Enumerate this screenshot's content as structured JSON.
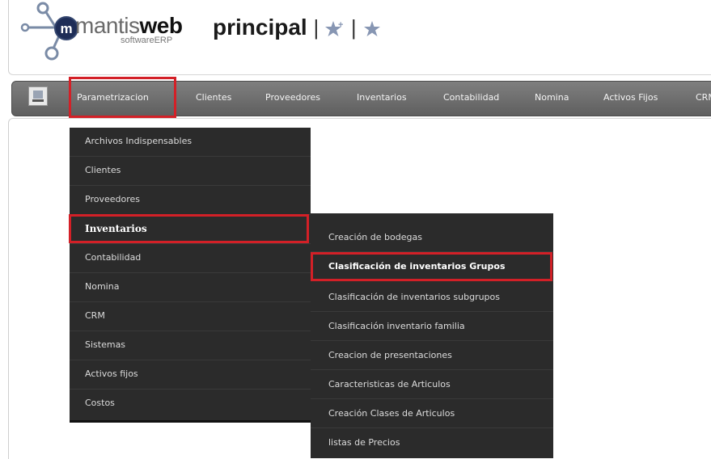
{
  "logo": {
    "word_light": "mantis",
    "word_bold": "web",
    "subtitle": "softwareERP"
  },
  "header": {
    "title": "principal",
    "sep1": "|",
    "sep2": "|"
  },
  "nav": {
    "items": [
      "Parametrizacion",
      "Clientes",
      "Proveedores",
      "Inventarios",
      "Contabilidad",
      "Nomina",
      "Activos Fijos",
      "CRM"
    ]
  },
  "menu": {
    "items": [
      "Archivos Indispensables",
      "Clientes",
      "Proveedores",
      "Inventarios",
      "Contabilidad",
      "Nomina",
      "CRM",
      "Sistemas",
      "Activos fijos",
      "Costos"
    ],
    "active": "Inventarios"
  },
  "submenu": {
    "items": [
      "Creación de bodegas",
      "Clasificación de inventarios Grupos",
      "Clasificación de inventarios subgrupos",
      "Clasificación inventario familia",
      "Creacion de presentaciones",
      "Caracteristicas de Articulos",
      "Creación Clases de Articulos",
      "listas de Precios"
    ],
    "active": "Clasificación de inventarios Grupos"
  },
  "colors": {
    "highlight": "#d32027",
    "menu_bg": "#2b2b2b",
    "nav_bg": "#6f6f6f",
    "logo_accent": "#7a8ba6"
  },
  "icons": [
    "mantis-logo-icon",
    "star-plus-icon",
    "star-icon",
    "home-icon"
  ]
}
